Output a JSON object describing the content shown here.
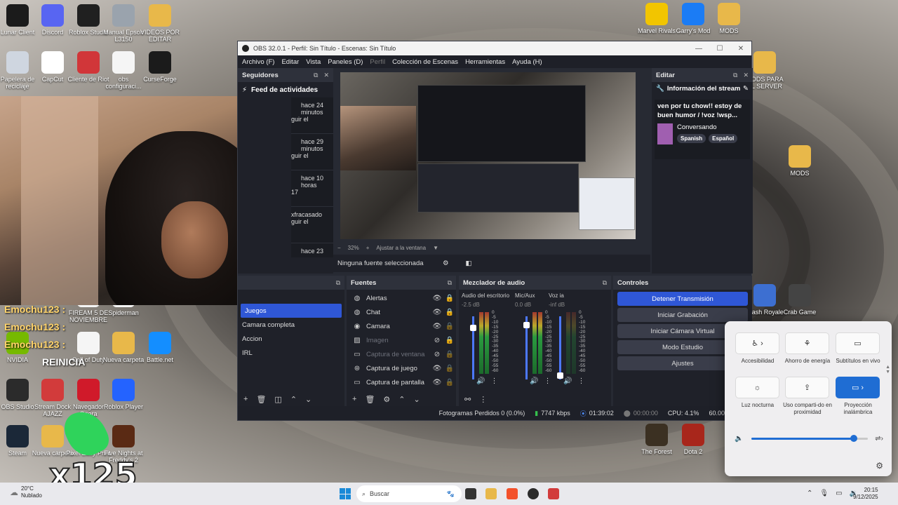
{
  "desktop_icons": [
    {
      "label": "Lunar Client",
      "icon": "lunar-icon",
      "color": "#1b1b1b"
    },
    {
      "label": "Discord",
      "icon": "discord-icon",
      "color": "#5865f2"
    },
    {
      "label": "Roblox Studio",
      "icon": "roblox-studio-icon",
      "color": "#202020"
    },
    {
      "label": "Manual Epson L3150",
      "icon": "cd-icon",
      "color": "#9aa3ad"
    },
    {
      "label": "VIDEOS POR EDITAR",
      "icon": "folder-icon",
      "color": "#e8b84a"
    },
    {
      "label": "Papelera de reciclaje",
      "icon": "recycle-bin-icon",
      "color": "#cfd6e0"
    },
    {
      "label": "CapCut",
      "icon": "capcut-icon",
      "color": "#ffffff"
    },
    {
      "label": "Cliente de Riot",
      "icon": "riot-icon",
      "color": "#d13639"
    },
    {
      "label": "obs configuraci...",
      "icon": "file-icon",
      "color": "#f5f5f5"
    },
    {
      "label": "CurseForge",
      "icon": "curseforge-icon",
      "color": "#1b1b1b"
    },
    {
      "label": "NVIDIA",
      "icon": "nvidia-icon",
      "color": "#76b900"
    },
    {
      "label": "Call of Duty",
      "icon": "file-icon",
      "color": "#f5f5f5"
    },
    {
      "label": "Nueva carpeta",
      "icon": "folder-icon",
      "color": "#e8b84a"
    },
    {
      "label": "Battle.net",
      "icon": "battlenet-icon",
      "color": "#148eff"
    },
    {
      "label": "OBS Studio",
      "icon": "obs-icon",
      "color": "#2b2b2b"
    },
    {
      "label": "Stream Dock AJAZZ",
      "icon": "streamdock-icon",
      "color": "#d23b3b"
    },
    {
      "label": "Navegador Opera",
      "icon": "opera-icon",
      "color": "#d01a2a"
    },
    {
      "label": "Roblox Player",
      "icon": "roblox-icon",
      "color": "#2463ff"
    },
    {
      "label": "Steam",
      "icon": "steam-icon",
      "color": "#1b2838"
    },
    {
      "label": "Nueva carpeta",
      "icon": "folder-icon",
      "color": "#e8b84a"
    },
    {
      "label": "Five Nights at Freddy's 2",
      "icon": "fnaf-icon",
      "color": "#5a2a14"
    },
    {
      "label": "Marvel Rivals",
      "icon": "marvel-rivals-icon",
      "color": "#f2c500"
    },
    {
      "label": "Garry's Mod",
      "icon": "gmod-icon",
      "color": "#1b7cf5"
    },
    {
      "label": "MODS",
      "icon": "folder-icon",
      "color": "#e8b84a"
    },
    {
      "label": "MODS PARA EL SERVER",
      "icon": "folder-icon",
      "color": "#e8b84a"
    },
    {
      "label": "MODS",
      "icon": "folder-icon",
      "color": "#e8b84a"
    },
    {
      "label": "Clash Royale",
      "icon": "clash-royale-icon",
      "color": "#3d6fd1"
    },
    {
      "label": "Crab Game",
      "icon": "crab-game-icon",
      "color": "#444"
    },
    {
      "label": "The Forest",
      "icon": "the-forest-icon",
      "color": "#3b3022"
    },
    {
      "label": "Dota 2",
      "icon": "dota-icon",
      "color": "#a8261b"
    },
    {
      "label": "FIREAM 5 DE NOVIEMBRE",
      "icon": "file-icon",
      "color": "#f5f5f5"
    },
    {
      "label": "Spiderman",
      "icon": "file-icon",
      "color": "#f5f5f5"
    },
    {
      "label": "Pixel Easy Print",
      "icon": "file-icon",
      "color": "#f5f5f5"
    }
  ],
  "stream_overlay": {
    "chat": [
      "Emochu123 :",
      "Emochu123 :",
      "Emochu123 :"
    ],
    "alert_text": "REINICIA",
    "multiplier": "x125"
  },
  "obs": {
    "title": "OBS 32.0.1 - Perfil: Sin Título - Escenas: Sin Título",
    "menu": [
      "Archivo (F)",
      "Editar",
      "Vista",
      "Paneles (D)",
      "Perfil",
      "Colección de Escenas",
      "Herramientas",
      "Ayuda (H)"
    ],
    "followers": {
      "title": "Seguidores",
      "feed_title": "Feed de actividades",
      "items": [
        {
          "time": "hace 24 minutos",
          "who": "guir el"
        },
        {
          "time": "hace 29 minutos",
          "who": "guir el"
        },
        {
          "time": "hace 10 horas",
          "who": "17"
        },
        {
          "time": "xfracasado",
          "who": "guir el"
        },
        {
          "time": "hace 23",
          "who": ""
        }
      ]
    },
    "preview": {
      "zoom": "32%",
      "fit_label": "Ajustar a la ventana",
      "no_source": "Ninguna fuente seleccionada"
    },
    "edit": {
      "title": "Editar",
      "info_title": "Información del stream",
      "stream_title": "ven por tu chow!! estoy de buen humor / !voz !wsp...",
      "category": "Conversando",
      "tags": [
        "Spanish",
        "Español"
      ]
    },
    "scenes": {
      "items": [
        "Juegos",
        "Camara completa",
        "Accion",
        "IRL"
      ],
      "selected": 0
    },
    "sources": {
      "title": "Fuentes",
      "items": [
        {
          "name": "Alertas",
          "icon": "browser-icon",
          "visible": true,
          "locked": true,
          "dim": false
        },
        {
          "name": "Chat",
          "icon": "browser-icon",
          "visible": true,
          "locked": true,
          "dim": false
        },
        {
          "name": "Camara",
          "icon": "camera-icon",
          "visible": true,
          "locked": false,
          "dim": false
        },
        {
          "name": "Imagen",
          "icon": "image-icon",
          "visible": false,
          "locked": true,
          "dim": true
        },
        {
          "name": "Captura de ventana",
          "icon": "window-icon",
          "visible": false,
          "locked": false,
          "dim": true
        },
        {
          "name": "Captura de juego",
          "icon": "gamepad-icon",
          "visible": true,
          "locked": false,
          "dim": false
        },
        {
          "name": "Captura de pantalla",
          "icon": "monitor-icon",
          "visible": true,
          "locked": false,
          "dim": false
        }
      ]
    },
    "mixer": {
      "title": "Mezclador de audio",
      "channels": [
        {
          "name": "Audio del escritorio",
          "db": "-2.5 dB",
          "level": 0.85
        },
        {
          "name": "Mic/Aux",
          "db": "0.0 dB",
          "level": 0.9
        },
        {
          "name": "Voz ia",
          "db": "-inf dB",
          "level": 0.0
        }
      ],
      "scale": [
        "0",
        "-5",
        "-10",
        "-15",
        "-20",
        "-25",
        "-30",
        "-35",
        "-40",
        "-45",
        "-50",
        "-55",
        "-60"
      ]
    },
    "controls": {
      "title": "Controles",
      "buttons": [
        "Detener Transmisión",
        "Iniciar Grabación",
        "Iniciar Cámara Virtual",
        "Modo Estudio",
        "Ajustes"
      ]
    },
    "status": {
      "dropped": "Fotogramas Perdidos 0 (0.0%)",
      "bitrate": "7747 kbps",
      "live_time": "01:39:02",
      "rec_time": "00:00:00",
      "cpu": "CPU: 4.1%",
      "fps": "60.00 / 60.00"
    }
  },
  "quick_settings": {
    "tiles": [
      {
        "label": "Accesibilidad",
        "glyph": "♿ ›",
        "on": false
      },
      {
        "label": "Ahorro de energía",
        "glyph": "⚘",
        "on": false
      },
      {
        "label": "Subtítulos en vivo",
        "glyph": "▭",
        "on": false
      },
      {
        "label": "Luz nocturna",
        "glyph": "☼",
        "on": false
      },
      {
        "label": "Uso comparti-do en proximidad",
        "glyph": "⇪",
        "on": false
      },
      {
        "label": "Proyección inalámbrica",
        "glyph": "▭ ›",
        "on": true
      }
    ],
    "volume": 0.88,
    "accent": "#1f6dd3"
  },
  "taskbar": {
    "weather_temp": "20°C",
    "weather_desc": "Nublado",
    "search_placeholder": "Buscar",
    "time": "20:15",
    "date": "9/12/2025"
  }
}
